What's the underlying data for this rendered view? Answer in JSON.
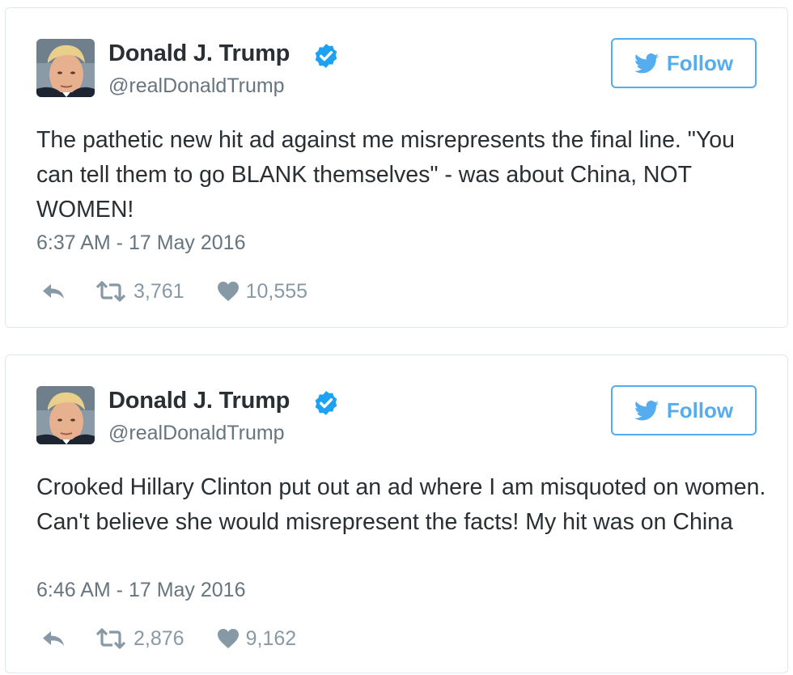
{
  "tweets": [
    {
      "author": {
        "name": "Donald J. Trump",
        "handle": "@realDonaldTrump",
        "verified": true
      },
      "follow_label": "Follow",
      "text": "The pathetic new hit ad against me misrepresents the final line. \"You can tell them to go BLANK themselves\" - was about China, NOT WOMEN!",
      "timestamp": "6:37 AM - 17 May 2016",
      "retweets": "3,761",
      "likes": "10,555"
    },
    {
      "author": {
        "name": "Donald J. Trump",
        "handle": "@realDonaldTrump",
        "verified": true
      },
      "follow_label": "Follow",
      "text": "Crooked Hillary Clinton put out an ad where I am misquoted on women. Can't believe she would misrepresent the facts! My hit was on China",
      "timestamp": "6:46 AM - 17 May 2016",
      "retweets": "2,876",
      "likes": "9,162"
    }
  ],
  "colors": {
    "accent": "#55acee",
    "verified": "#1da1f2",
    "text": "#292f33",
    "muted": "#66757f",
    "action": "#8899a6",
    "border": "#e1e8ed"
  },
  "icons": {
    "verified": "verified-badge-icon",
    "follow": "bird-icon",
    "reply": "reply-icon",
    "retweet": "retweet-icon",
    "like": "heart-icon"
  }
}
